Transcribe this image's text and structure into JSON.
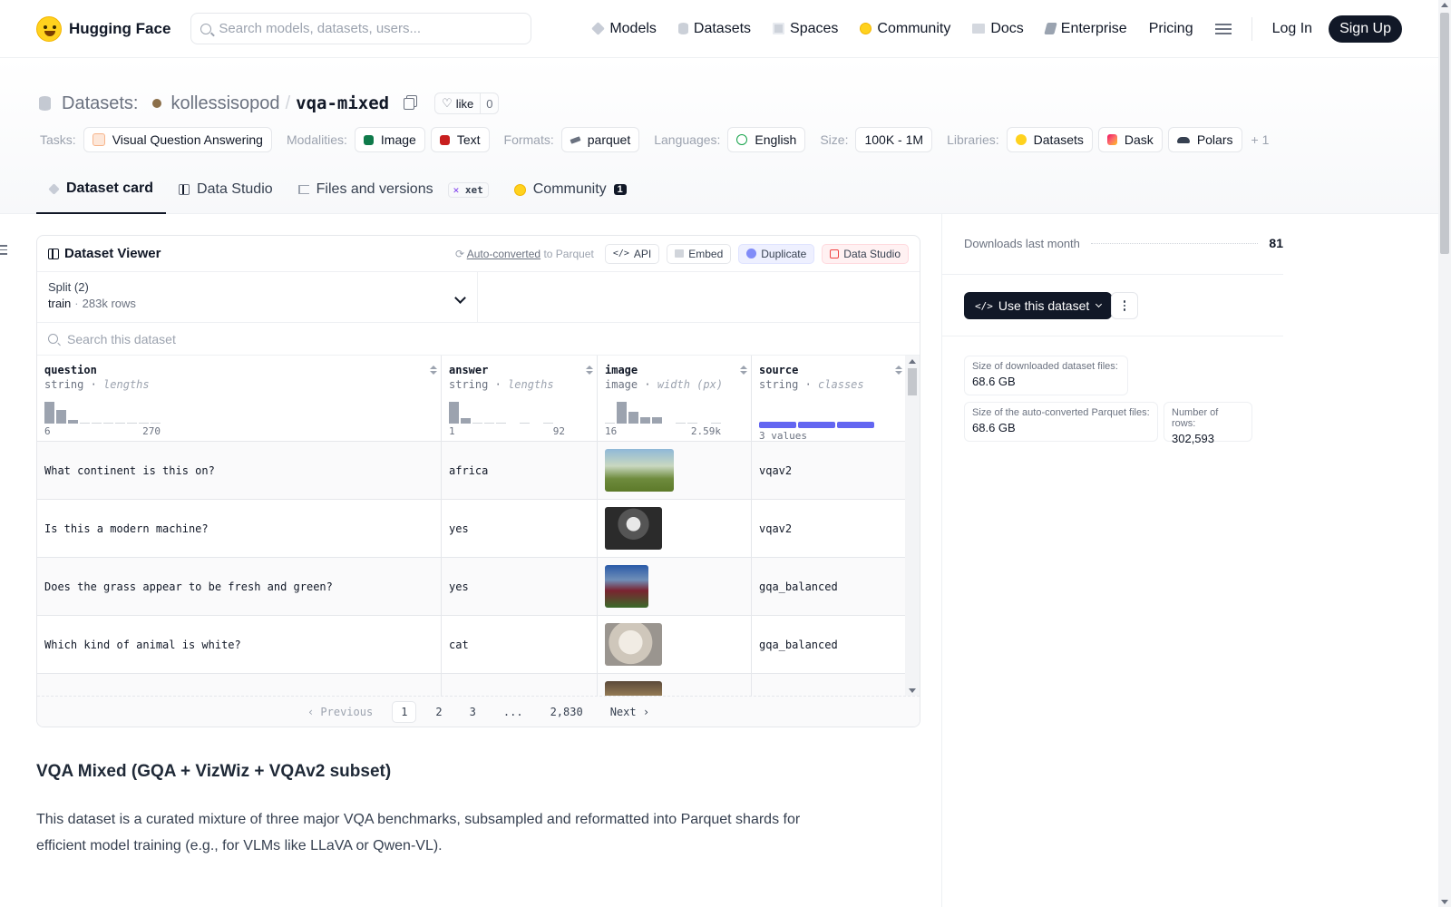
{
  "nav": {
    "brand": "Hugging Face",
    "search_placeholder": "Search models, datasets, users...",
    "links": [
      "Models",
      "Datasets",
      "Spaces",
      "Community",
      "Docs",
      "Enterprise",
      "Pricing"
    ],
    "login": "Log In",
    "signup": "Sign Up"
  },
  "header": {
    "section": "Datasets:",
    "owner": "kollessisopod",
    "separator": "/",
    "repo": "vqa-mixed",
    "like_label": "like",
    "like_count": "0",
    "tags": {
      "tasks_label": "Tasks:",
      "task": "Visual Question Answering",
      "modalities_label": "Modalities:",
      "modality_image": "Image",
      "modality_text": "Text",
      "formats_label": "Formats:",
      "format": "parquet",
      "languages_label": "Languages:",
      "language": "English",
      "size_label": "Size:",
      "size": "100K - 1M",
      "libraries_label": "Libraries:",
      "lib_datasets": "Datasets",
      "lib_dask": "Dask",
      "lib_polars": "Polars",
      "more": "+ 1"
    },
    "tabs": {
      "card": "Dataset card",
      "studio": "Data Studio",
      "files": "Files and versions",
      "xet": "xet",
      "community": "Community",
      "community_count": "1"
    }
  },
  "viewer": {
    "title": "Dataset Viewer",
    "auto_converted": "Auto-converted",
    "to_parquet": "to Parquet",
    "api": "API",
    "embed": "Embed",
    "duplicate": "Duplicate",
    "data_studio": "Data Studio",
    "split_label": "Split (2)",
    "split_value": "train",
    "split_rows": "283k rows",
    "search_placeholder": "Search this dataset",
    "columns": [
      {
        "name": "question",
        "type": "string",
        "stat": "lengths",
        "min": "6",
        "max": "270"
      },
      {
        "name": "answer",
        "type": "string",
        "stat": "lengths",
        "min": "1",
        "max": "92"
      },
      {
        "name": "image",
        "type": "image",
        "stat": "width (px)",
        "min": "16",
        "max": "2.59k"
      },
      {
        "name": "source",
        "type": "string",
        "stat": "classes",
        "summary": "3 values"
      }
    ],
    "rows": [
      {
        "question": "What continent is this on?",
        "answer": "africa",
        "source": "vqav2"
      },
      {
        "question": "Is this a modern machine?",
        "answer": "yes",
        "source": "vqav2"
      },
      {
        "question": "Does the grass appear to be fresh and green?",
        "answer": "yes",
        "source": "gqa_balanced"
      },
      {
        "question": "Which kind of animal is white?",
        "answer": "cat",
        "source": "gqa_balanced"
      }
    ],
    "pager": {
      "previous": "Previous",
      "pages": [
        "1",
        "2",
        "3",
        "...",
        "2,830"
      ],
      "next": "Next"
    }
  },
  "article": {
    "title": "VQA Mixed (GQA + VizWiz + VQAv2 subset)",
    "body": "This dataset is a curated mixture of three major VQA benchmarks, subsampled and reformatted into Parquet shards for efficient model training (e.g., for VLMs like LLaVA or Qwen-VL)."
  },
  "sidebar": {
    "downloads_label": "Downloads last month",
    "downloads_value": "81",
    "use_dataset": "Use this dataset",
    "downloaded_size_label": "Size of downloaded dataset files:",
    "downloaded_size": "68.6 GB",
    "parquet_size_label": "Size of the auto-converted Parquet files:",
    "parquet_size": "68.6 GB",
    "rows_label": "Number of rows:",
    "rows_value": "302,593"
  }
}
